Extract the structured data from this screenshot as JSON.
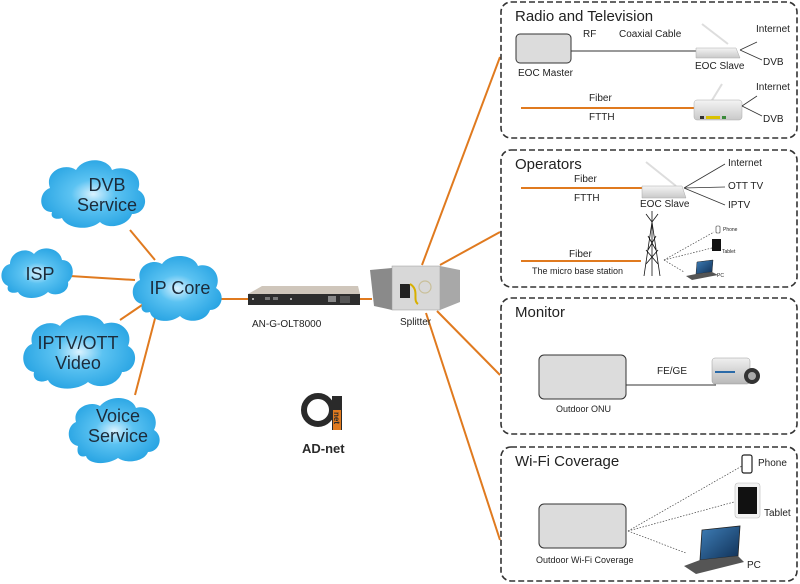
{
  "colors": {
    "link": "#e07a1f",
    "cloud": "#2fa8e6",
    "cloud_highlight": "#c9ecff",
    "box_border": "#333333",
    "device_box": "#dcdcdc",
    "logo_dark": "#2a2a2a",
    "logo_accent": "#e07a1f"
  },
  "clouds": [
    {
      "id": "dvb",
      "lines": [
        "DVB",
        "Service"
      ]
    },
    {
      "id": "isp",
      "lines": [
        "ISP"
      ]
    },
    {
      "id": "ip-core",
      "lines": [
        "IP Core"
      ]
    },
    {
      "id": "iptv",
      "lines": [
        "IPTV/OTT",
        "Video"
      ]
    },
    {
      "id": "voice",
      "lines": [
        "Voice",
        "Service"
      ]
    }
  ],
  "olt": {
    "label": "AN-G-OLT8000"
  },
  "splitter": {
    "label": "Splitter"
  },
  "logo": {
    "mark": "net",
    "name": "AD-net"
  },
  "panels": {
    "radio_tv": {
      "title": "Radio and Television",
      "eoc_master": "EOC Master",
      "rf": "RF",
      "coaxial": "Coaxial Cable",
      "eoc_slave": "EOC Slave",
      "internet_1": "Internet",
      "dvb_1": "DVB",
      "fiber": "Fiber",
      "ftth": "FTTH",
      "internet_2": "Internet",
      "dvb_2": "DVB"
    },
    "operators": {
      "title": "Operators",
      "fiber_1": "Fiber",
      "ftth": "FTTH",
      "eoc_slave": "EOC Slave",
      "internet": "Internet",
      "ott_tv": "OTT TV",
      "iptv": "IPTV",
      "fiber_2": "Fiber",
      "base_station": "The micro base station",
      "phone": "Phone",
      "tablet": "Tablet",
      "pc": "PC"
    },
    "monitor": {
      "title": "Monitor",
      "onu": "Outdoor ONU",
      "link": "FE/GE"
    },
    "wifi": {
      "title": "Wi-Fi Coverage",
      "device": "Outdoor Wi-Fi Coverage",
      "phone": "Phone",
      "tablet": "Tablet",
      "pc": "PC"
    }
  }
}
